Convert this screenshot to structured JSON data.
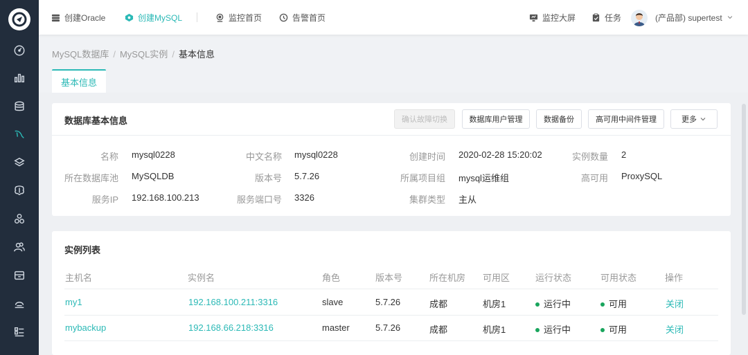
{
  "topbar": {
    "items": [
      {
        "label": "创建Oracle",
        "icon": "database-icon"
      },
      {
        "label": "创建MySQL",
        "icon": "mysql-icon"
      },
      {
        "label": "监控首页",
        "icon": "monitor-icon"
      },
      {
        "label": "告警首页",
        "icon": "alarm-icon"
      }
    ],
    "right": {
      "screen_label": "监控大屏",
      "task_label": "任务",
      "user_label": "(产品部)  supertest"
    }
  },
  "breadcrumb": {
    "items": [
      "MySQL数据库",
      "MySQL实例",
      "基本信息"
    ]
  },
  "tab": {
    "label": "基本信息"
  },
  "basic_info": {
    "title": "数据库基本信息",
    "buttons": {
      "failover": "确认故障切换",
      "user_manage": "数据库用户管理",
      "backup": "数据备份",
      "ha_middleware": "高可用中间件管理",
      "more": "更多"
    },
    "fields": [
      {
        "label": "名称",
        "value": "mysql0228"
      },
      {
        "label": "中文名称",
        "value": "mysql0228"
      },
      {
        "label": "创建时间",
        "value": "2020-02-28 15:20:02"
      },
      {
        "label": "实例数量",
        "value": "2"
      },
      {
        "label": "所在数据库池",
        "value": "MySQLDB"
      },
      {
        "label": "版本号",
        "value": "5.7.26"
      },
      {
        "label": "所属项目组",
        "value": "mysql运维组"
      },
      {
        "label": "高可用",
        "value": "ProxySQL"
      },
      {
        "label": "服务IP",
        "value": "192.168.100.213"
      },
      {
        "label": "服务端口号",
        "value": "3326"
      },
      {
        "label": "集群类型",
        "value": "主从"
      }
    ]
  },
  "instances": {
    "title": "实例列表",
    "columns": [
      "主机名",
      "实例名",
      "角色",
      "版本号",
      "所在机房",
      "可用区",
      "运行状态",
      "可用状态",
      "操作"
    ],
    "rows": [
      {
        "host": "my1",
        "instance": "192.168.100.211:3316",
        "role": "slave",
        "version": "5.7.26",
        "room": "成都",
        "zone": "机房1",
        "run": "运行中",
        "avail": "可用",
        "action": "关闭"
      },
      {
        "host": "mybackup",
        "instance": "192.168.66.218:3316",
        "role": "master",
        "version": "5.7.26",
        "room": "成都",
        "zone": "机房1",
        "run": "运行中",
        "avail": "可用",
        "action": "关闭"
      }
    ]
  },
  "colors": {
    "accent": "#2bb9b6",
    "sidebar": "#222d3c",
    "status_green": "#19a55d"
  }
}
